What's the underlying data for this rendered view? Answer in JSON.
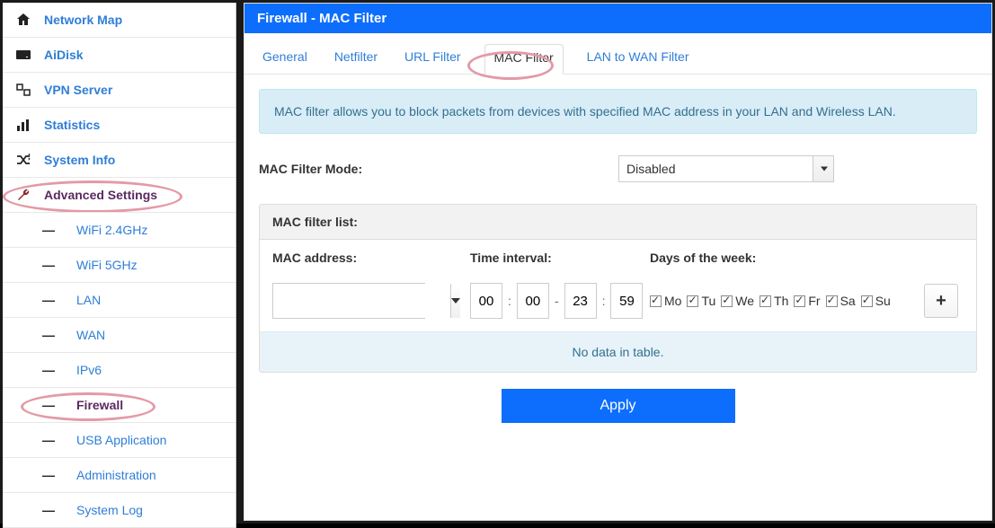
{
  "sidebar": {
    "items": [
      {
        "label": "Network Map",
        "icon": "home"
      },
      {
        "label": "AiDisk",
        "icon": "disk"
      },
      {
        "label": "VPN Server",
        "icon": "swap"
      },
      {
        "label": "Statistics",
        "icon": "bars"
      },
      {
        "label": "System Info",
        "icon": "shuffle"
      }
    ],
    "section_label": "Advanced Settings",
    "subs": [
      {
        "label": "WiFi 2.4GHz"
      },
      {
        "label": "WiFi 5GHz"
      },
      {
        "label": "LAN"
      },
      {
        "label": "WAN"
      },
      {
        "label": "IPv6"
      },
      {
        "label": "Firewall"
      },
      {
        "label": "USB Application"
      },
      {
        "label": "Administration"
      },
      {
        "label": "System Log"
      }
    ]
  },
  "main": {
    "title": "Firewall - MAC Filter",
    "tabs": [
      "General",
      "Netfilter",
      "URL Filter",
      "MAC Filter",
      "LAN to WAN Filter"
    ],
    "active_tab": "MAC Filter",
    "info": "MAC filter allows you to block packets from devices with specified MAC address in your LAN and Wireless LAN.",
    "mode_label": "MAC Filter Mode:",
    "mode_value": "Disabled",
    "panel_title": "MAC filter list:",
    "col_mac": "MAC address:",
    "col_time": "Time interval:",
    "col_days": "Days of the week:",
    "time": {
      "h1": "00",
      "m1": "00",
      "h2": "23",
      "m2": "59"
    },
    "days": [
      "Mo",
      "Tu",
      "We",
      "Th",
      "Fr",
      "Sa",
      "Su"
    ],
    "empty": "No data in table.",
    "apply": "Apply"
  }
}
